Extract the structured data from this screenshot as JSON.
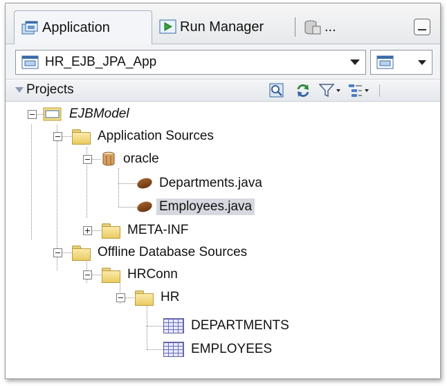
{
  "tabs": {
    "application": "Application",
    "run_manager": "Run Manager",
    "databases": "..."
  },
  "app_selector": {
    "value": "HR_EJB_JPA_App"
  },
  "projects": {
    "label": "Projects"
  },
  "tree": {
    "project": "EJBModel",
    "application_sources": "Application Sources",
    "package": "oracle",
    "file1": "Departments.java",
    "file2": "Employees.java",
    "meta_inf": "META-INF",
    "offline_db_sources": "Offline Database Sources",
    "connection": "HRConn",
    "schema": "HR",
    "table1": "DEPARTMENTS",
    "table2": "EMPLOYEES"
  },
  "colors": {
    "selection": "#d5d8de",
    "folder": "#eacb62",
    "accent": "#3b6fb6"
  }
}
